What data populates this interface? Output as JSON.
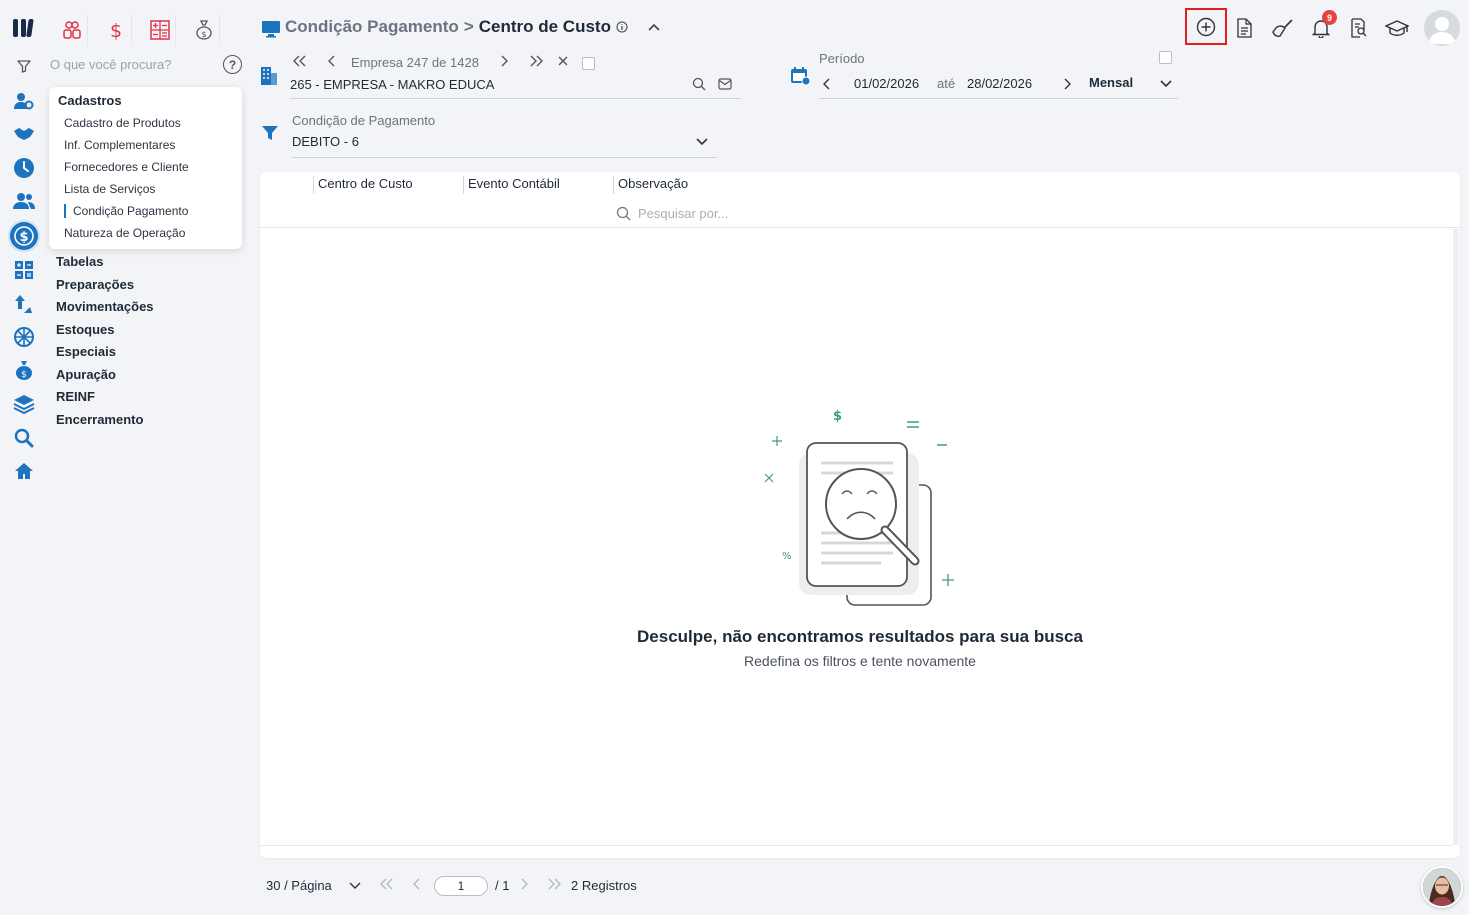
{
  "search": {
    "placeholder": "O que você procura?",
    "help": "?"
  },
  "popover": {
    "title": "Cadastros",
    "items": [
      "Cadastro de Produtos",
      "Inf. Complementares",
      "Fornecedores e Cliente",
      "Lista de Serviços",
      "Condição Pagamento",
      "Natureza de Operação"
    ],
    "selected_index": 4
  },
  "menu": [
    "Tabelas",
    "Preparações",
    "Movimentações",
    "Estoques",
    "Especiais",
    "Apuração",
    "REINF",
    "Encerramento"
  ],
  "header": {
    "parent": "Condição Pagamento",
    "separator": ">",
    "current": "Centro de Custo"
  },
  "notifications": {
    "count": "9"
  },
  "company": {
    "counter": "Empresa 247 de 1428",
    "name": "265 - EMPRESA - MAKRO EDUCA"
  },
  "period": {
    "label": "Período",
    "start": "01/02/2026",
    "connector": "até",
    "end": "28/02/2026",
    "mode": "Mensal"
  },
  "filter": {
    "label": "Condição de Pagamento",
    "value": "DEBITO - 6"
  },
  "grid": {
    "columns": [
      "Centro de Custo",
      "Evento Contábil",
      "Observação"
    ],
    "search_placeholder": "Pesquisar por...",
    "empty_title": "Desculpe, não encontramos resultados para sua busca",
    "empty_subtitle": "Redefina os filtros e tente novamente"
  },
  "pagination": {
    "per_page": "30 / Página",
    "page": "1",
    "total": "/ 1",
    "records": "2 Registros"
  },
  "colors": {
    "accent": "#1e73be",
    "brand_red": "#e0344a",
    "highlight_red": "#e02020",
    "illustration_green": "#3f9f6a"
  }
}
